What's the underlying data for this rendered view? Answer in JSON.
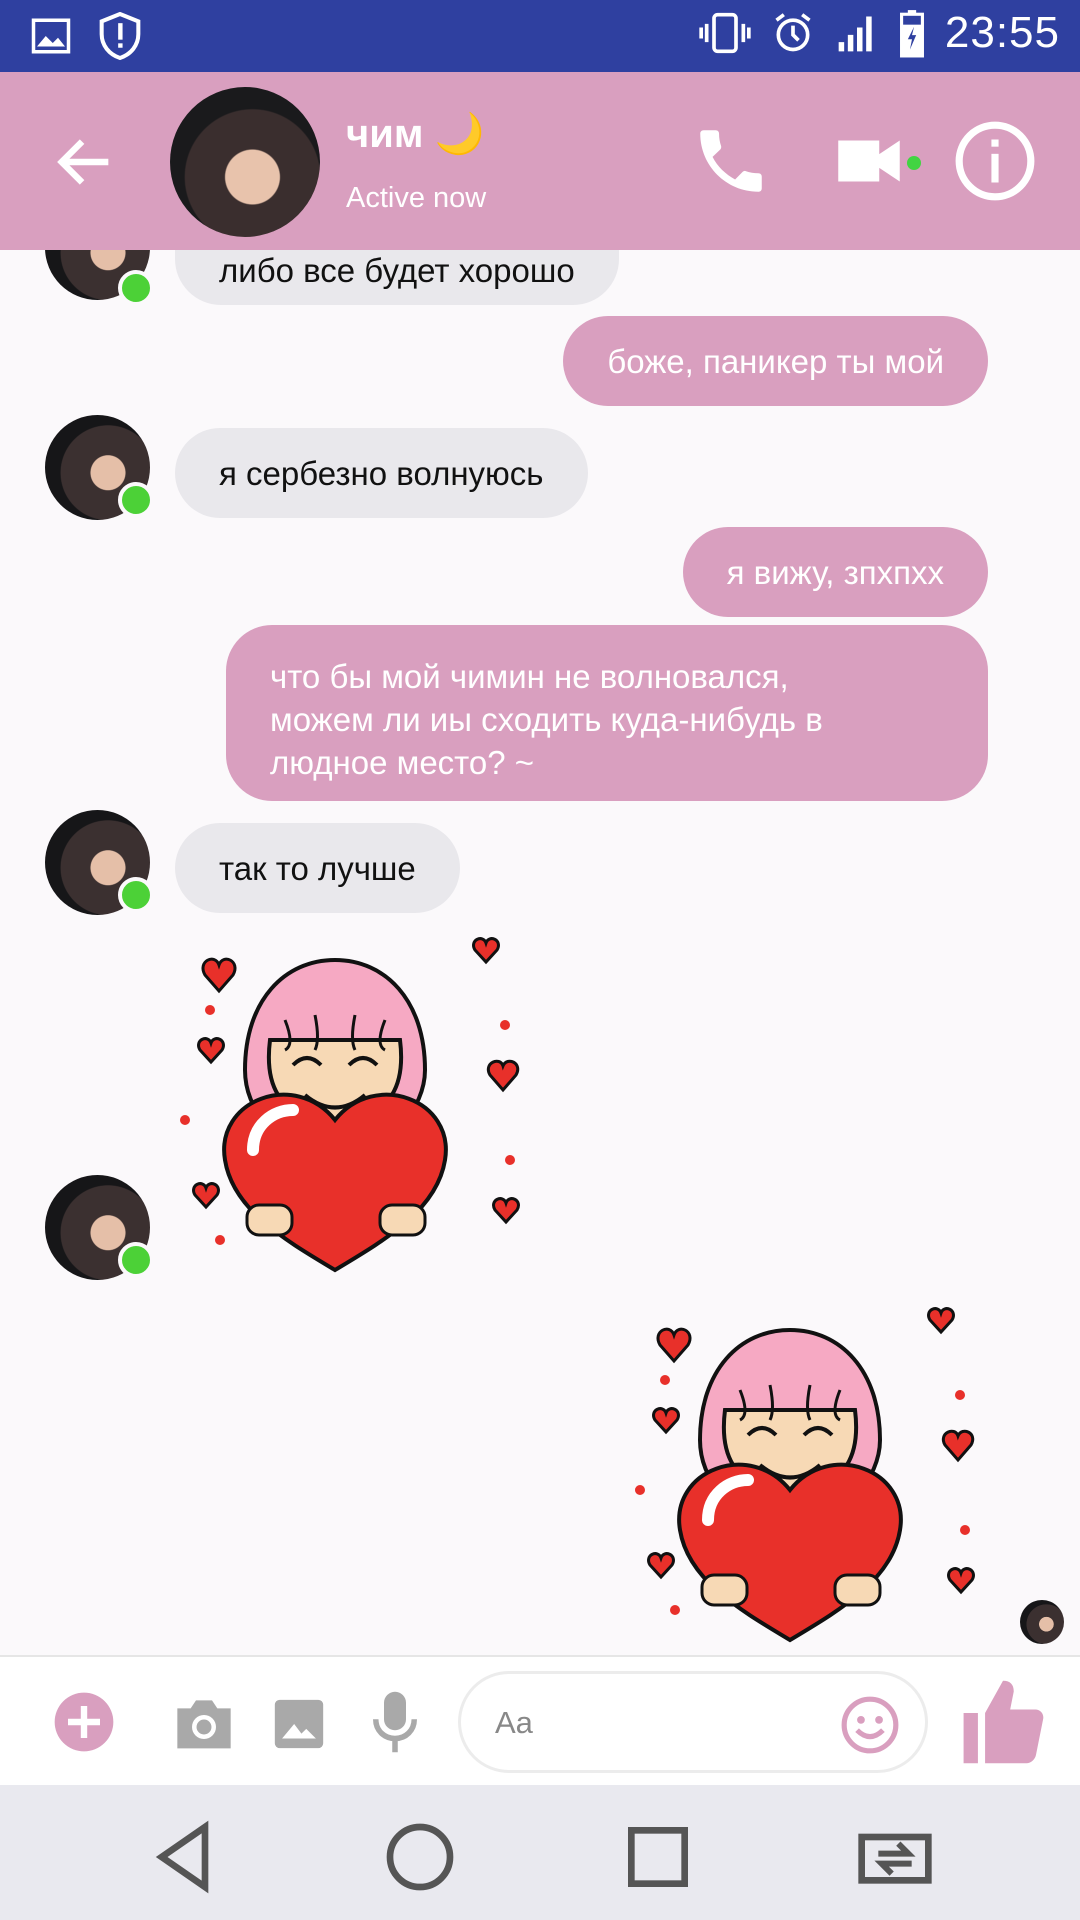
{
  "status_bar": {
    "time": "23:55",
    "icons": [
      "image-icon",
      "shield-alert-icon",
      "vibrate-icon",
      "alarm-icon",
      "signal-icon",
      "battery-charging-icon"
    ]
  },
  "header": {
    "contact_name": "чим",
    "contact_emoji": "🌙",
    "status": "Active now",
    "accent_color": "#d99fbf",
    "icons": [
      "back-arrow-icon",
      "phone-icon",
      "video-camera-icon",
      "info-icon"
    ]
  },
  "messages": [
    {
      "side": "in",
      "text": "либо все будет хорошо"
    },
    {
      "side": "out",
      "text": "боже, паникер ты мой"
    },
    {
      "side": "in",
      "text": "я сербезно волнуюсь"
    },
    {
      "side": "out",
      "text": "я вижу, зпхпхх"
    },
    {
      "side": "out",
      "lines": [
        "что бы мой чимин не волновался,",
        "можем ли иы сходить куда-нибудь в",
        "людное место? ~"
      ]
    },
    {
      "side": "in",
      "text": "так то лучше"
    },
    {
      "side": "in",
      "sticker": "girl-holding-heart-sticker"
    },
    {
      "side": "out",
      "sticker": "girl-holding-heart-sticker"
    }
  ],
  "composer": {
    "placeholder": "Aa",
    "icons": [
      "plus-icon",
      "camera-icon",
      "image-icon",
      "microphone-icon",
      "emoji-icon",
      "thumbs-up-icon"
    ]
  },
  "navbar": {
    "icons": [
      "nav-back-icon",
      "nav-home-icon",
      "nav-recents-icon",
      "screen-rotate-icon"
    ]
  }
}
